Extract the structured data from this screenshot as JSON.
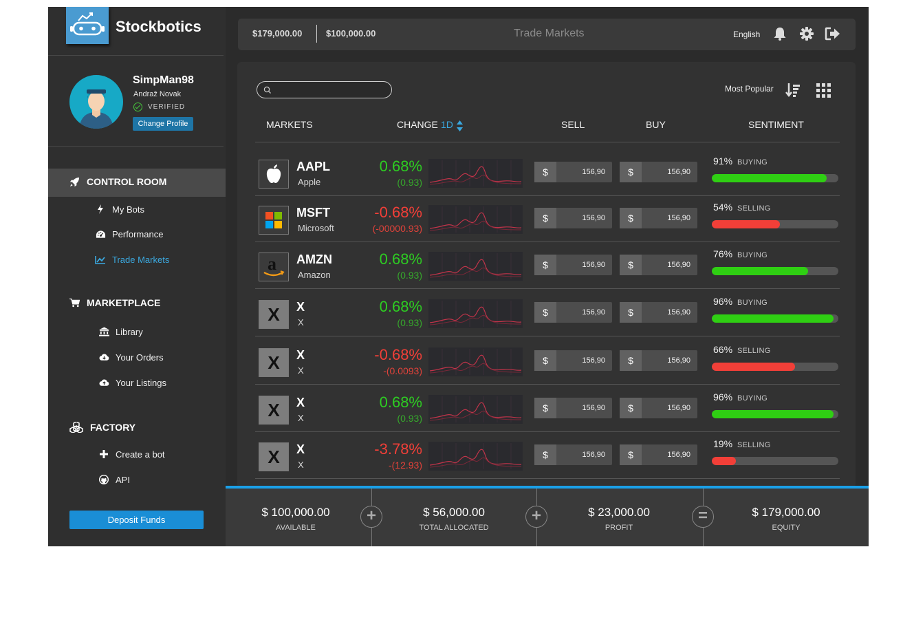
{
  "app": {
    "name": "Stockbotics"
  },
  "profile": {
    "username": "SimpMan98",
    "real_name": "Andraž Novak",
    "verified_label": "VERIFIED",
    "change_profile_label": "Change Profile"
  },
  "sidebar": {
    "sections": [
      {
        "label": "CONTROL ROOM",
        "icon": "rocket-icon",
        "items": [
          {
            "label": "My Bots",
            "icon": "bolt-icon"
          },
          {
            "label": "Performance",
            "icon": "gauge-icon"
          },
          {
            "label": "Trade Markets",
            "icon": "chart-line-icon",
            "active": true
          }
        ]
      },
      {
        "label": "MARKETPLACE",
        "icon": "cart-icon",
        "items": [
          {
            "label": "Library",
            "icon": "bank-icon"
          },
          {
            "label": "Your Orders",
            "icon": "cloud-download-icon"
          },
          {
            "label": "Your Listings",
            "icon": "cloud-upload-icon"
          }
        ]
      },
      {
        "label": "FACTORY",
        "icon": "cubes-icon",
        "items": [
          {
            "label": "Create a bot",
            "icon": "plus-icon"
          },
          {
            "label": "API",
            "icon": "github-icon"
          }
        ]
      }
    ],
    "deposit_label": "Deposit Funds"
  },
  "topbar": {
    "equity": "$179,000.00",
    "available": "$100,000.00",
    "title": "Trade Markets",
    "language": "English",
    "icons": [
      "bell-icon",
      "gear-icon",
      "sign-out-icon"
    ]
  },
  "markets": {
    "search_placeholder": "",
    "sort_label": "Most Popular",
    "columns": {
      "markets": "MARKETS",
      "change": "CHANGE",
      "timeframe": "1D",
      "sell": "SELL",
      "buy": "BUY",
      "sentiment": "SENTIMENT"
    },
    "rows": [
      {
        "ticker": "AAPL",
        "name": "Apple",
        "logo": "apple-logo",
        "change_pct": "0.68%",
        "change_abs": "(0.93)",
        "direction": "up",
        "sell": "156,90",
        "buy": "156,90",
        "sentiment_pct": "91%",
        "sentiment_label": "BUYING",
        "sentiment_value": 0.91
      },
      {
        "ticker": "MSFT",
        "name": "Microsoft",
        "logo": "microsoft-logo",
        "change_pct": "-0.68%",
        "change_abs": "(-00000.93)",
        "direction": "down",
        "sell": "156,90",
        "buy": "156,90",
        "sentiment_pct": "54%",
        "sentiment_label": "SELLING",
        "sentiment_value": 0.54
      },
      {
        "ticker": "AMZN",
        "name": "Amazon",
        "logo": "amazon-logo",
        "change_pct": "0.68%",
        "change_abs": "(0.93)",
        "direction": "up",
        "sell": "156,90",
        "buy": "156,90",
        "sentiment_pct": "76%",
        "sentiment_label": "BUYING",
        "sentiment_value": 0.76
      },
      {
        "ticker": "X",
        "name": "X",
        "logo": "X",
        "change_pct": "0.68%",
        "change_abs": "(0.93)",
        "direction": "up",
        "sell": "156,90",
        "buy": "156,90",
        "sentiment_pct": "96%",
        "sentiment_label": "BUYING",
        "sentiment_value": 0.96
      },
      {
        "ticker": "X",
        "name": "X",
        "logo": "X",
        "change_pct": "-0.68%",
        "change_abs": "-(0.0093)",
        "direction": "down",
        "sell": "156,90",
        "buy": "156,90",
        "sentiment_pct": "66%",
        "sentiment_label": "SELLING",
        "sentiment_value": 0.66
      },
      {
        "ticker": "X",
        "name": "X",
        "logo": "X",
        "change_pct": "0.68%",
        "change_abs": "(0.93)",
        "direction": "up",
        "sell": "156,90",
        "buy": "156,90",
        "sentiment_pct": "96%",
        "sentiment_label": "BUYING",
        "sentiment_value": 0.96
      },
      {
        "ticker": "X",
        "name": "X",
        "logo": "X",
        "change_pct": "-3.78%",
        "change_abs": "-(12.93)",
        "direction": "down",
        "sell": "156,90",
        "buy": "156,90",
        "sentiment_pct": "19%",
        "sentiment_label": "SELLING",
        "sentiment_value": 0.19
      }
    ],
    "currency_symbol": "$"
  },
  "footer": {
    "stats": [
      {
        "value": "$ 100,000.00",
        "label": "AVAILABLE"
      },
      {
        "value": "$ 56,000.00",
        "label": "TOTAL ALLOCATED"
      },
      {
        "value": "$ 23,000.00",
        "label": "PROFIT"
      },
      {
        "value": "$ 179,000.00",
        "label": "EQUITY"
      }
    ],
    "operators": [
      "+",
      "+",
      "="
    ]
  },
  "colors": {
    "accent": "#1aa0e8",
    "up": "#2dcd22",
    "down": "#f23f38",
    "buying_bar": "#2fcf13",
    "selling_bar": "#f23f38"
  }
}
